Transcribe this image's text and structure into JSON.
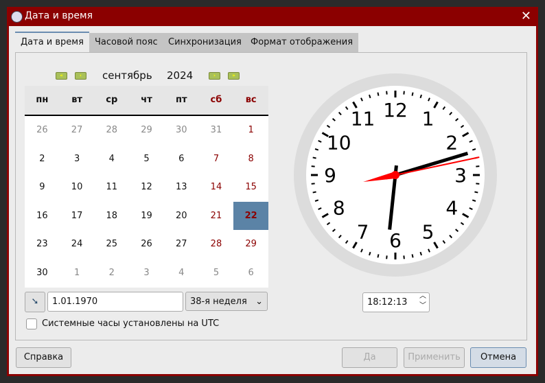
{
  "window": {
    "title": "Дата и время",
    "close": "✕"
  },
  "tabs": [
    "Дата и время",
    "Часовой пояс",
    "Синхронизация",
    "Формат отображения"
  ],
  "calendar": {
    "month": "сентябрь",
    "year": "2024",
    "weekdays": [
      "пн",
      "вт",
      "ср",
      "чт",
      "пт",
      "сб",
      "вс"
    ],
    "weeks": [
      [
        "26",
        "27",
        "28",
        "29",
        "30",
        "31",
        "1"
      ],
      [
        "2",
        "3",
        "4",
        "5",
        "6",
        "7",
        "8"
      ],
      [
        "9",
        "10",
        "11",
        "12",
        "13",
        "14",
        "15"
      ],
      [
        "16",
        "17",
        "18",
        "19",
        "20",
        "21",
        "22"
      ],
      [
        "23",
        "24",
        "25",
        "26",
        "27",
        "28",
        "29"
      ],
      [
        "30",
        "1",
        "2",
        "3",
        "4",
        "5",
        "6"
      ]
    ],
    "selected": "22",
    "nav": [
      "«",
      "‹",
      "›",
      "»"
    ]
  },
  "date_input": "1.01.1970",
  "week_select": "38-я неделя",
  "utc_checkbox": {
    "label": "Системные часы установлены на UTC",
    "checked": false
  },
  "clock": {
    "numbers": [
      "12",
      "1",
      "2",
      "3",
      "4",
      "5",
      "6",
      "7",
      "8",
      "9",
      "10",
      "11"
    ],
    "time": "18:12:13"
  },
  "buttons": {
    "help": "Справка",
    "ok": "Да",
    "apply": "Применить",
    "cancel": "Отмена"
  },
  "colors": {
    "frame": "#8b0000",
    "selected": "#5b83a6",
    "second_hand": "#ff0000"
  }
}
